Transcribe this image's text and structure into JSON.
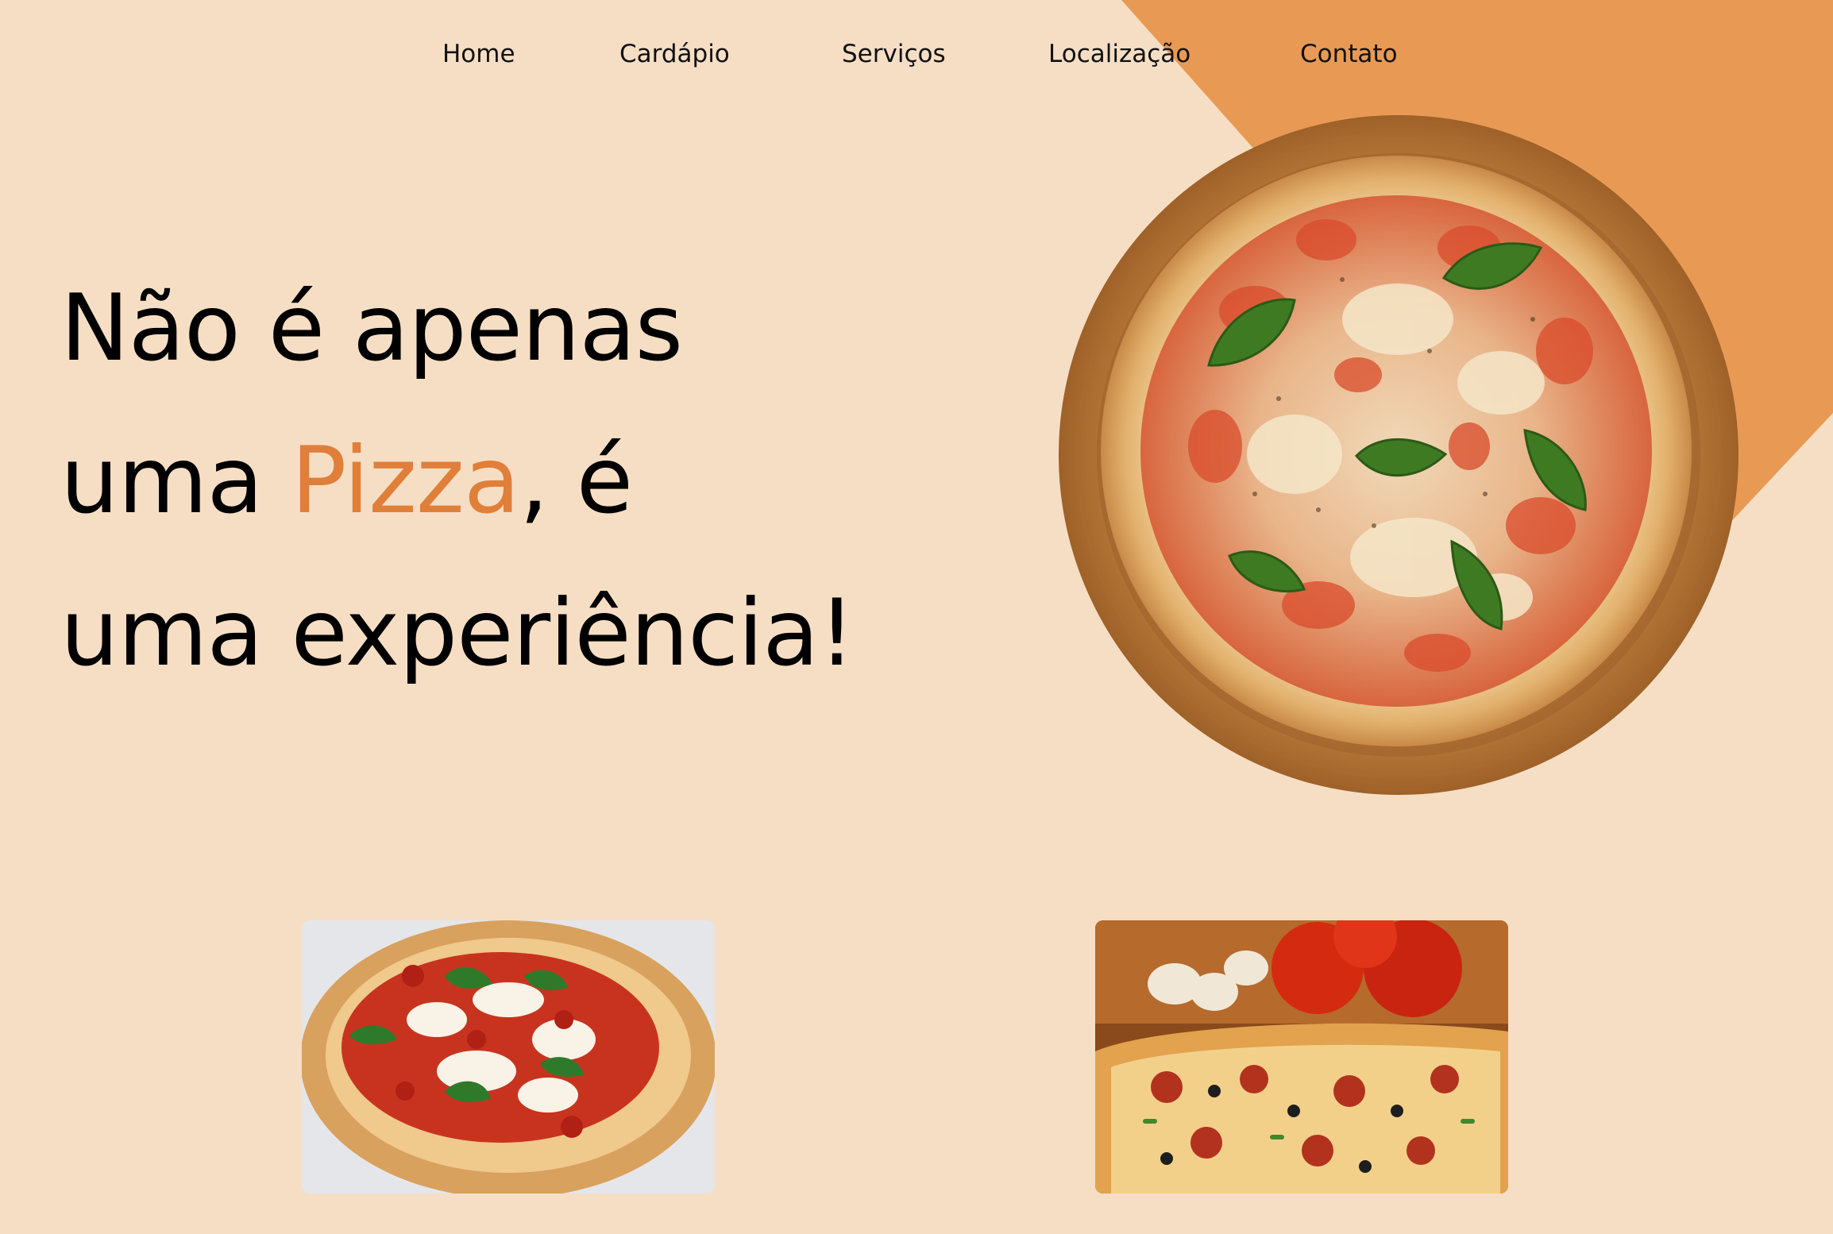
{
  "nav": {
    "items": [
      {
        "label": "Home"
      },
      {
        "label": "Cardápio"
      },
      {
        "label": "Serviços"
      },
      {
        "label": "Localização"
      },
      {
        "label": "Contato"
      }
    ]
  },
  "hero": {
    "line1": "Não é apenas",
    "line2_before": "uma ",
    "line2_highlight": "Pizza",
    "line2_after": ", é",
    "line3": "uma experiência!"
  },
  "colors": {
    "background": "#F6DEC5",
    "accent_shape": "#E89A54",
    "highlight_text": "#E07F3A",
    "text": "#000000"
  },
  "images": {
    "hero": "pizza-margherita-on-wooden-board",
    "thumb_1": "neapolitan-pizza-margherita",
    "thumb_2": "supreme-pizza-slice-with-tomatoes-and-mushrooms"
  }
}
